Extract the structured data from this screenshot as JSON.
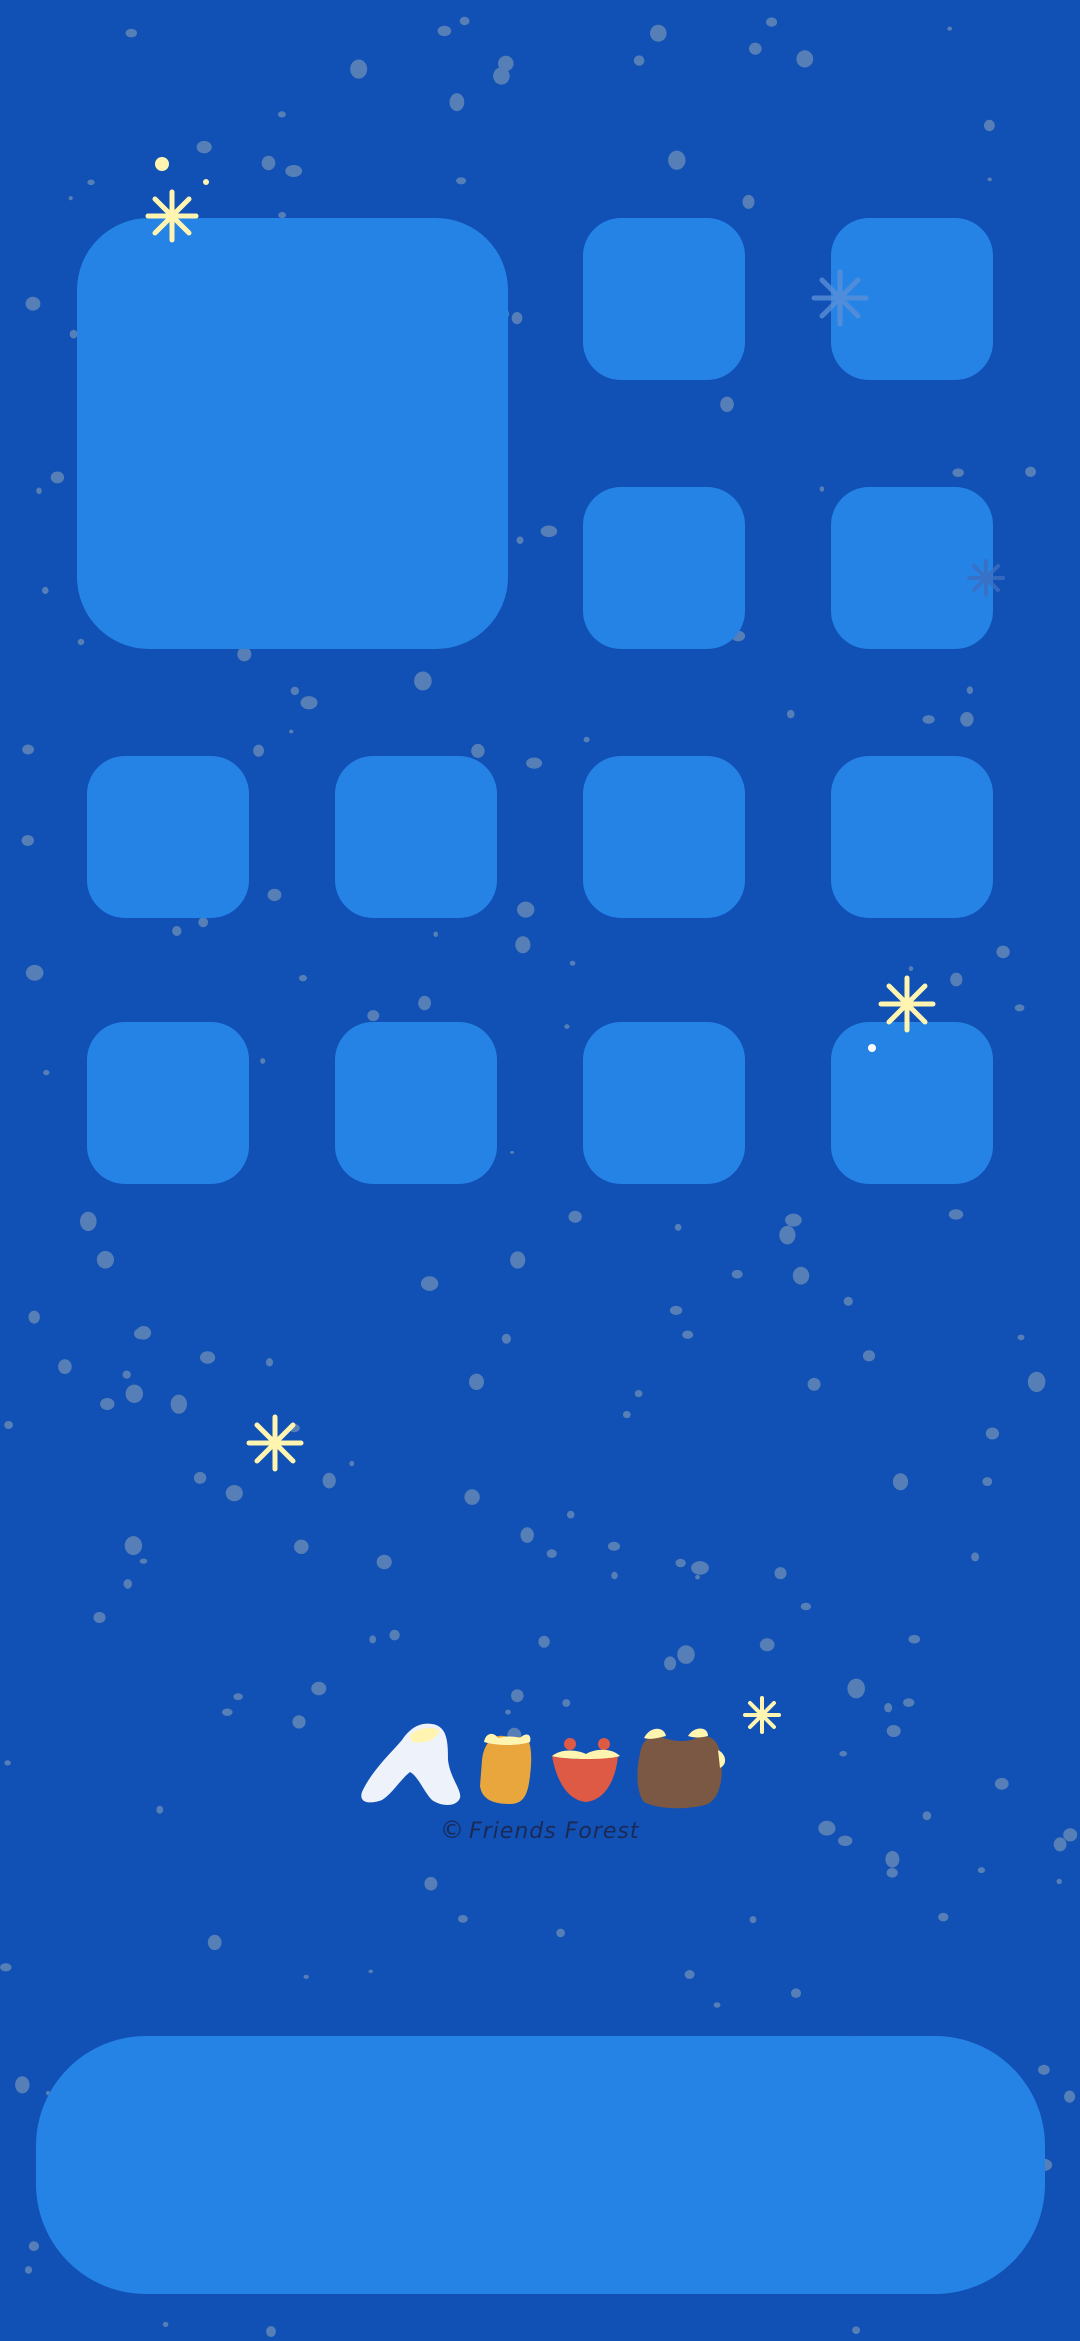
{
  "wallpaper": {
    "background_color": "#1150b4",
    "slot_color": "#2683e6",
    "speck_color": "#6f8fb8",
    "sparkle_color": "#fff4b0"
  },
  "home_screen": {
    "widget_slots": 1,
    "icon_slots": 12,
    "dock": 1
  },
  "illustration": {
    "characters": [
      "white-rabbit",
      "orange-cat",
      "red-crab",
      "brown-bear"
    ],
    "credit_symbol": "©",
    "credit_text": "Friends Forest"
  }
}
